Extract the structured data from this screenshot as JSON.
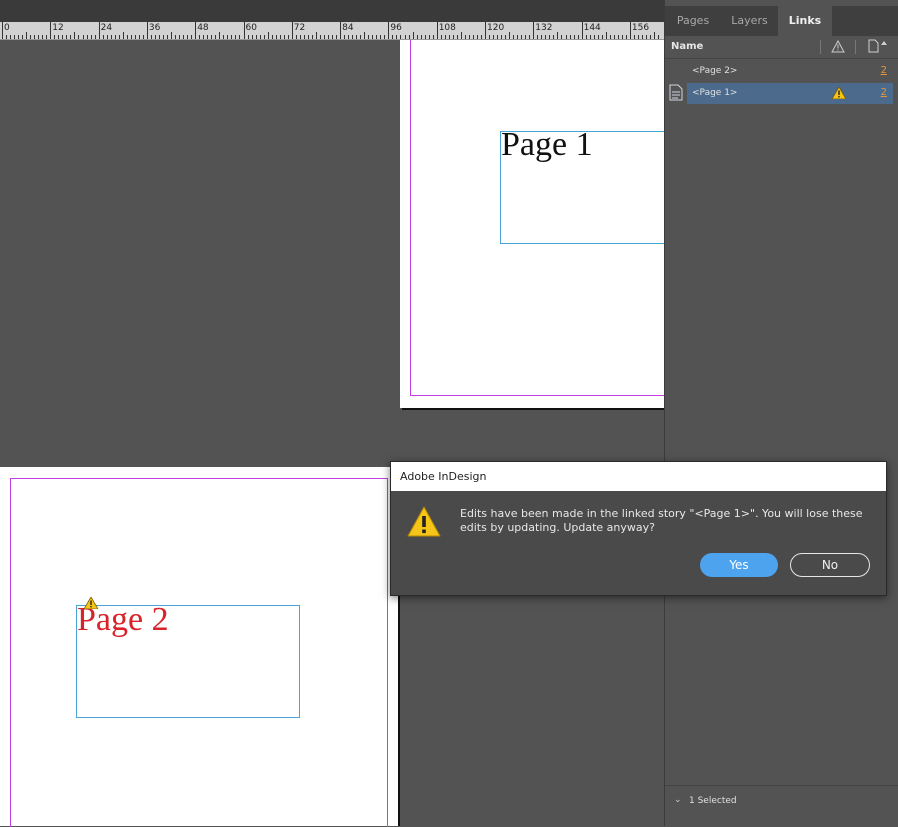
{
  "ruler": {
    "labels": [
      "0",
      "12",
      "24",
      "36",
      "48",
      "60",
      "72",
      "84",
      "96",
      "108",
      "120",
      "132",
      "144",
      "156"
    ]
  },
  "document": {
    "page1_text": "Page 1",
    "page2_text": "Page 2"
  },
  "panel": {
    "tabs": [
      {
        "label": "Pages",
        "active": false
      },
      {
        "label": "Layers",
        "active": false
      },
      {
        "label": "Links",
        "active": true
      }
    ],
    "column_header": "Name",
    "links": [
      {
        "name": "<Page 2>",
        "page": "2",
        "selected": false,
        "warning": false
      },
      {
        "name": "<Page 1>",
        "page": "2",
        "selected": true,
        "warning": true
      }
    ],
    "footer": "1 Selected"
  },
  "dialog": {
    "title": "Adobe InDesign",
    "message": "Edits have been made in the linked story \"<Page 1>\". You will lose these edits by updating. Update anyway?",
    "yes_label": "Yes",
    "no_label": "No"
  },
  "colors": {
    "accent": "#4ea3ee",
    "warning": "#f5c518",
    "link_number": "#e0963c",
    "selection": "#4b6a8c",
    "margin_guide": "#c040e0",
    "frame": "#4aa3d6",
    "page2_text": "#d8232a"
  }
}
